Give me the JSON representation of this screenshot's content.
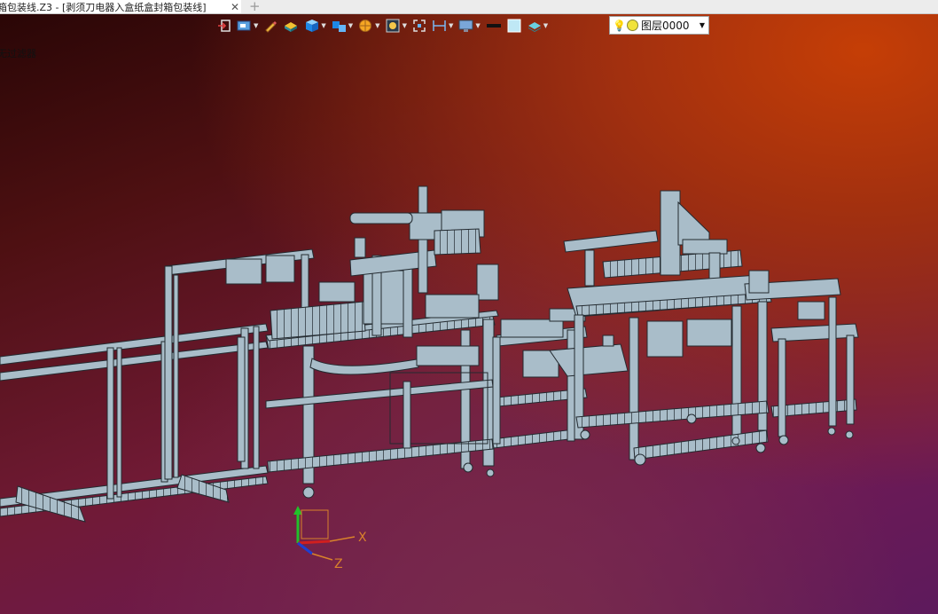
{
  "tab": {
    "title": "箱包装线.Z3 - [剥须刀电器入盒纸盒封箱包装线]",
    "close_icon": "close-icon",
    "new_tab_icon": "plus-icon"
  },
  "viewport": {
    "filter_label": "无过滤器"
  },
  "toolbar": {
    "items": [
      {
        "name": "exit-sketch-icon",
        "has_dropdown": false
      },
      {
        "name": "view-manager-icon",
        "has_dropdown": true
      },
      {
        "name": "pencil-icon",
        "has_dropdown": false
      },
      {
        "name": "shaded-view-icon",
        "has_dropdown": false
      },
      {
        "name": "cube-icon",
        "has_dropdown": true
      },
      {
        "name": "view-orientation-icon",
        "has_dropdown": true
      },
      {
        "name": "render-mode-icon",
        "has_dropdown": true
      },
      {
        "name": "zoom-icon",
        "has_dropdown": true
      },
      {
        "name": "fit-view-icon",
        "has_dropdown": false
      },
      {
        "name": "dimension-icon",
        "has_dropdown": true
      },
      {
        "name": "display-settings-icon",
        "has_dropdown": true
      },
      {
        "name": "line-color-icon",
        "has_dropdown": false
      },
      {
        "name": "fill-color-icon",
        "has_dropdown": false
      },
      {
        "name": "layer-style-icon",
        "has_dropdown": true
      }
    ]
  },
  "layer": {
    "value": "图层0000",
    "bulb_icon": "lightbulb-icon",
    "dot_color": "#f1e33a"
  },
  "triad": {
    "x_label": "X",
    "z_label": "Z"
  },
  "colors": {
    "model_fill": "#a9bdc9",
    "model_line": "#232a30",
    "accent_orange": "#d9822b"
  }
}
